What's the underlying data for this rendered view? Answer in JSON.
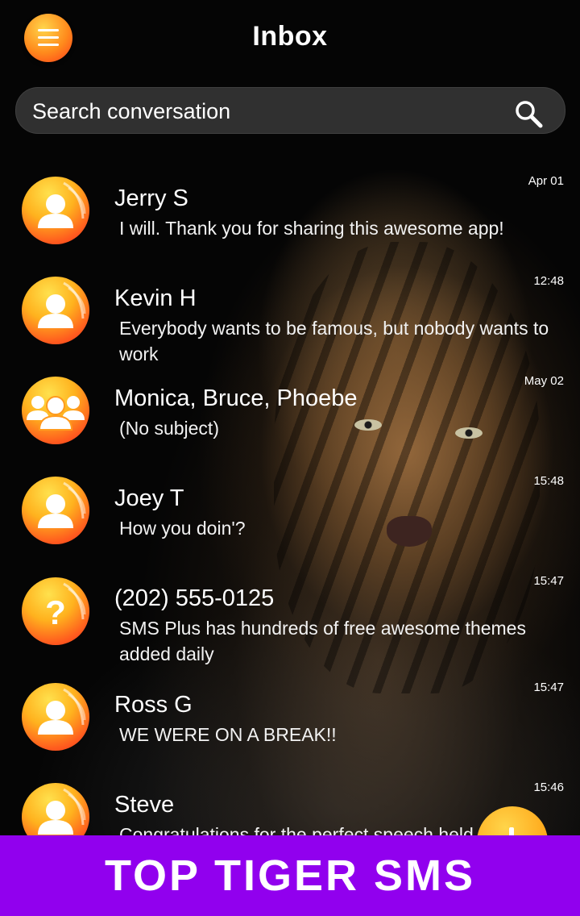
{
  "header": {
    "title": "Inbox"
  },
  "search": {
    "placeholder": "Search conversation"
  },
  "conversations": [
    {
      "name": "Jerry S",
      "snippet": "I will. Thank you for sharing this awesome app!",
      "time": "Apr 01",
      "avatar": "person-icon"
    },
    {
      "name": "Kevin H",
      "snippet": "Everybody wants to be famous, but nobody wants to work",
      "time": "12:48",
      "avatar": "person-icon"
    },
    {
      "name": "Monica, Bruce, Phoebe",
      "snippet": "(No subject)",
      "time": "May 02",
      "avatar": "group-icon"
    },
    {
      "name": "Joey T",
      "snippet": "How you doin'?",
      "time": "15:48",
      "avatar": "person-icon"
    },
    {
      "name": "(202) 555-0125",
      "snippet": "SMS Plus has hundreds of free awesome themes added daily",
      "time": "15:47",
      "avatar": "unknown-contact-icon"
    },
    {
      "name": "Ross G",
      "snippet": "WE WERE ON A BREAK!!",
      "time": "15:47",
      "avatar": "person-icon"
    },
    {
      "name": "Steve",
      "snippet": "Congratulations for the perfect speech held today",
      "time": "15:46",
      "avatar": "person-icon"
    }
  ],
  "banner": {
    "text": "TOP TIGER SMS"
  },
  "colors": {
    "accent_orange": "#ff8a1c",
    "banner_purple": "#9100ee"
  }
}
